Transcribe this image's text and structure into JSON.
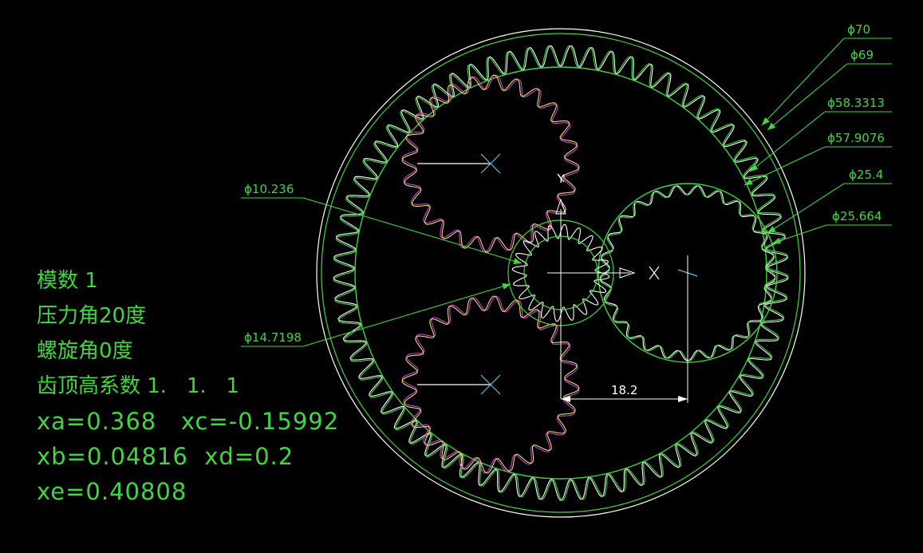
{
  "drawing": {
    "dimensions": [
      {
        "id": "d70",
        "label": "ϕ70"
      },
      {
        "id": "d69",
        "label": "ϕ69"
      },
      {
        "id": "d58",
        "label": "ϕ58.3313"
      },
      {
        "id": "d57",
        "label": "ϕ57.9076"
      },
      {
        "id": "d254",
        "label": "ϕ25.4"
      },
      {
        "id": "d25664",
        "label": "ϕ25.664"
      },
      {
        "id": "d10",
        "label": "ϕ10.236"
      },
      {
        "id": "d14",
        "label": "ϕ14.7198"
      }
    ],
    "offset_label": "18.2",
    "axis_label": "Y"
  },
  "gears": {
    "ring_teeth": 69,
    "sun_teeth": 10,
    "planet_teeth": 24,
    "big_planet_teeth": 25
  },
  "notes": [
    "模数 1",
    "压力角20度",
    "螺旋角0度",
    "齿顶高系数 1.   1.   1",
    "xa=0.368   xc=-0.15992",
    "xb=0.04816  xd=0.2",
    "xe=0.40808"
  ],
  "colors": {
    "background": "#000000",
    "green": "#3fd63f",
    "white": "#ffffff",
    "magenta": "#d040d0",
    "yellow": "#e8e060",
    "cyan": "#60c0e0"
  }
}
